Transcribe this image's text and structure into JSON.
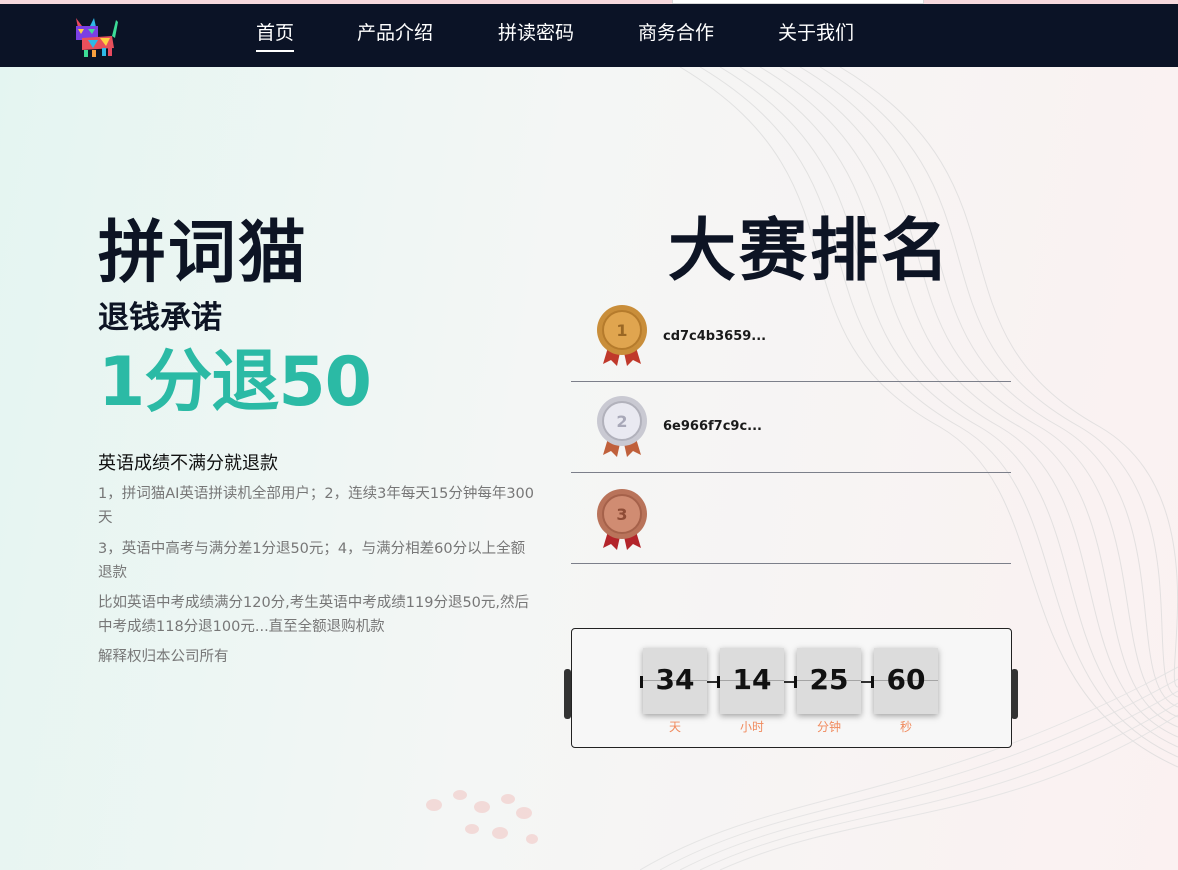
{
  "nav": {
    "items": [
      {
        "label": "首页",
        "active": true
      },
      {
        "label": "产品介绍"
      },
      {
        "label": "拼读密码"
      },
      {
        "label": "商务合作"
      },
      {
        "label": "关于我们"
      }
    ]
  },
  "hero": {
    "title": "拼词猫",
    "subtitle": "退钱承诺",
    "offer": "1分退50",
    "desc_heading": "英语成绩不满分就退款",
    "desc_lines": [
      "1，拼词猫AI英语拼读机全部用户；2，连续3年每天15分钟每年300天",
      "3，英语中高考与满分差1分退50元；4，与满分相差60分以上全额退款",
      "比如英语中考成绩满分120分,考生英语中考成绩119分退50元,然后中考成绩118分退100元...直至全额退购机款",
      "解释权归本公司所有"
    ]
  },
  "ranking": {
    "title": "大赛排名",
    "rows": [
      {
        "medal_icon": "gold-medal-icon",
        "rank": "1",
        "name": "cd7c4b3659..."
      },
      {
        "medal_icon": "silver-medal-icon",
        "rank": "2",
        "name": "6e966f7c9c..."
      },
      {
        "medal_icon": "bronze-medal-icon",
        "rank": "3",
        "name": ""
      }
    ]
  },
  "countdown": {
    "cells": [
      {
        "value": "34",
        "unit": "天"
      },
      {
        "value": "14",
        "unit": "小时"
      },
      {
        "value": "25",
        "unit": "分钟"
      },
      {
        "value": "60",
        "unit": "秒"
      }
    ]
  },
  "colors": {
    "nav_bg": "#0b1326",
    "accent_teal": "#2bbaa5",
    "unit_orange": "#f08a5d"
  }
}
